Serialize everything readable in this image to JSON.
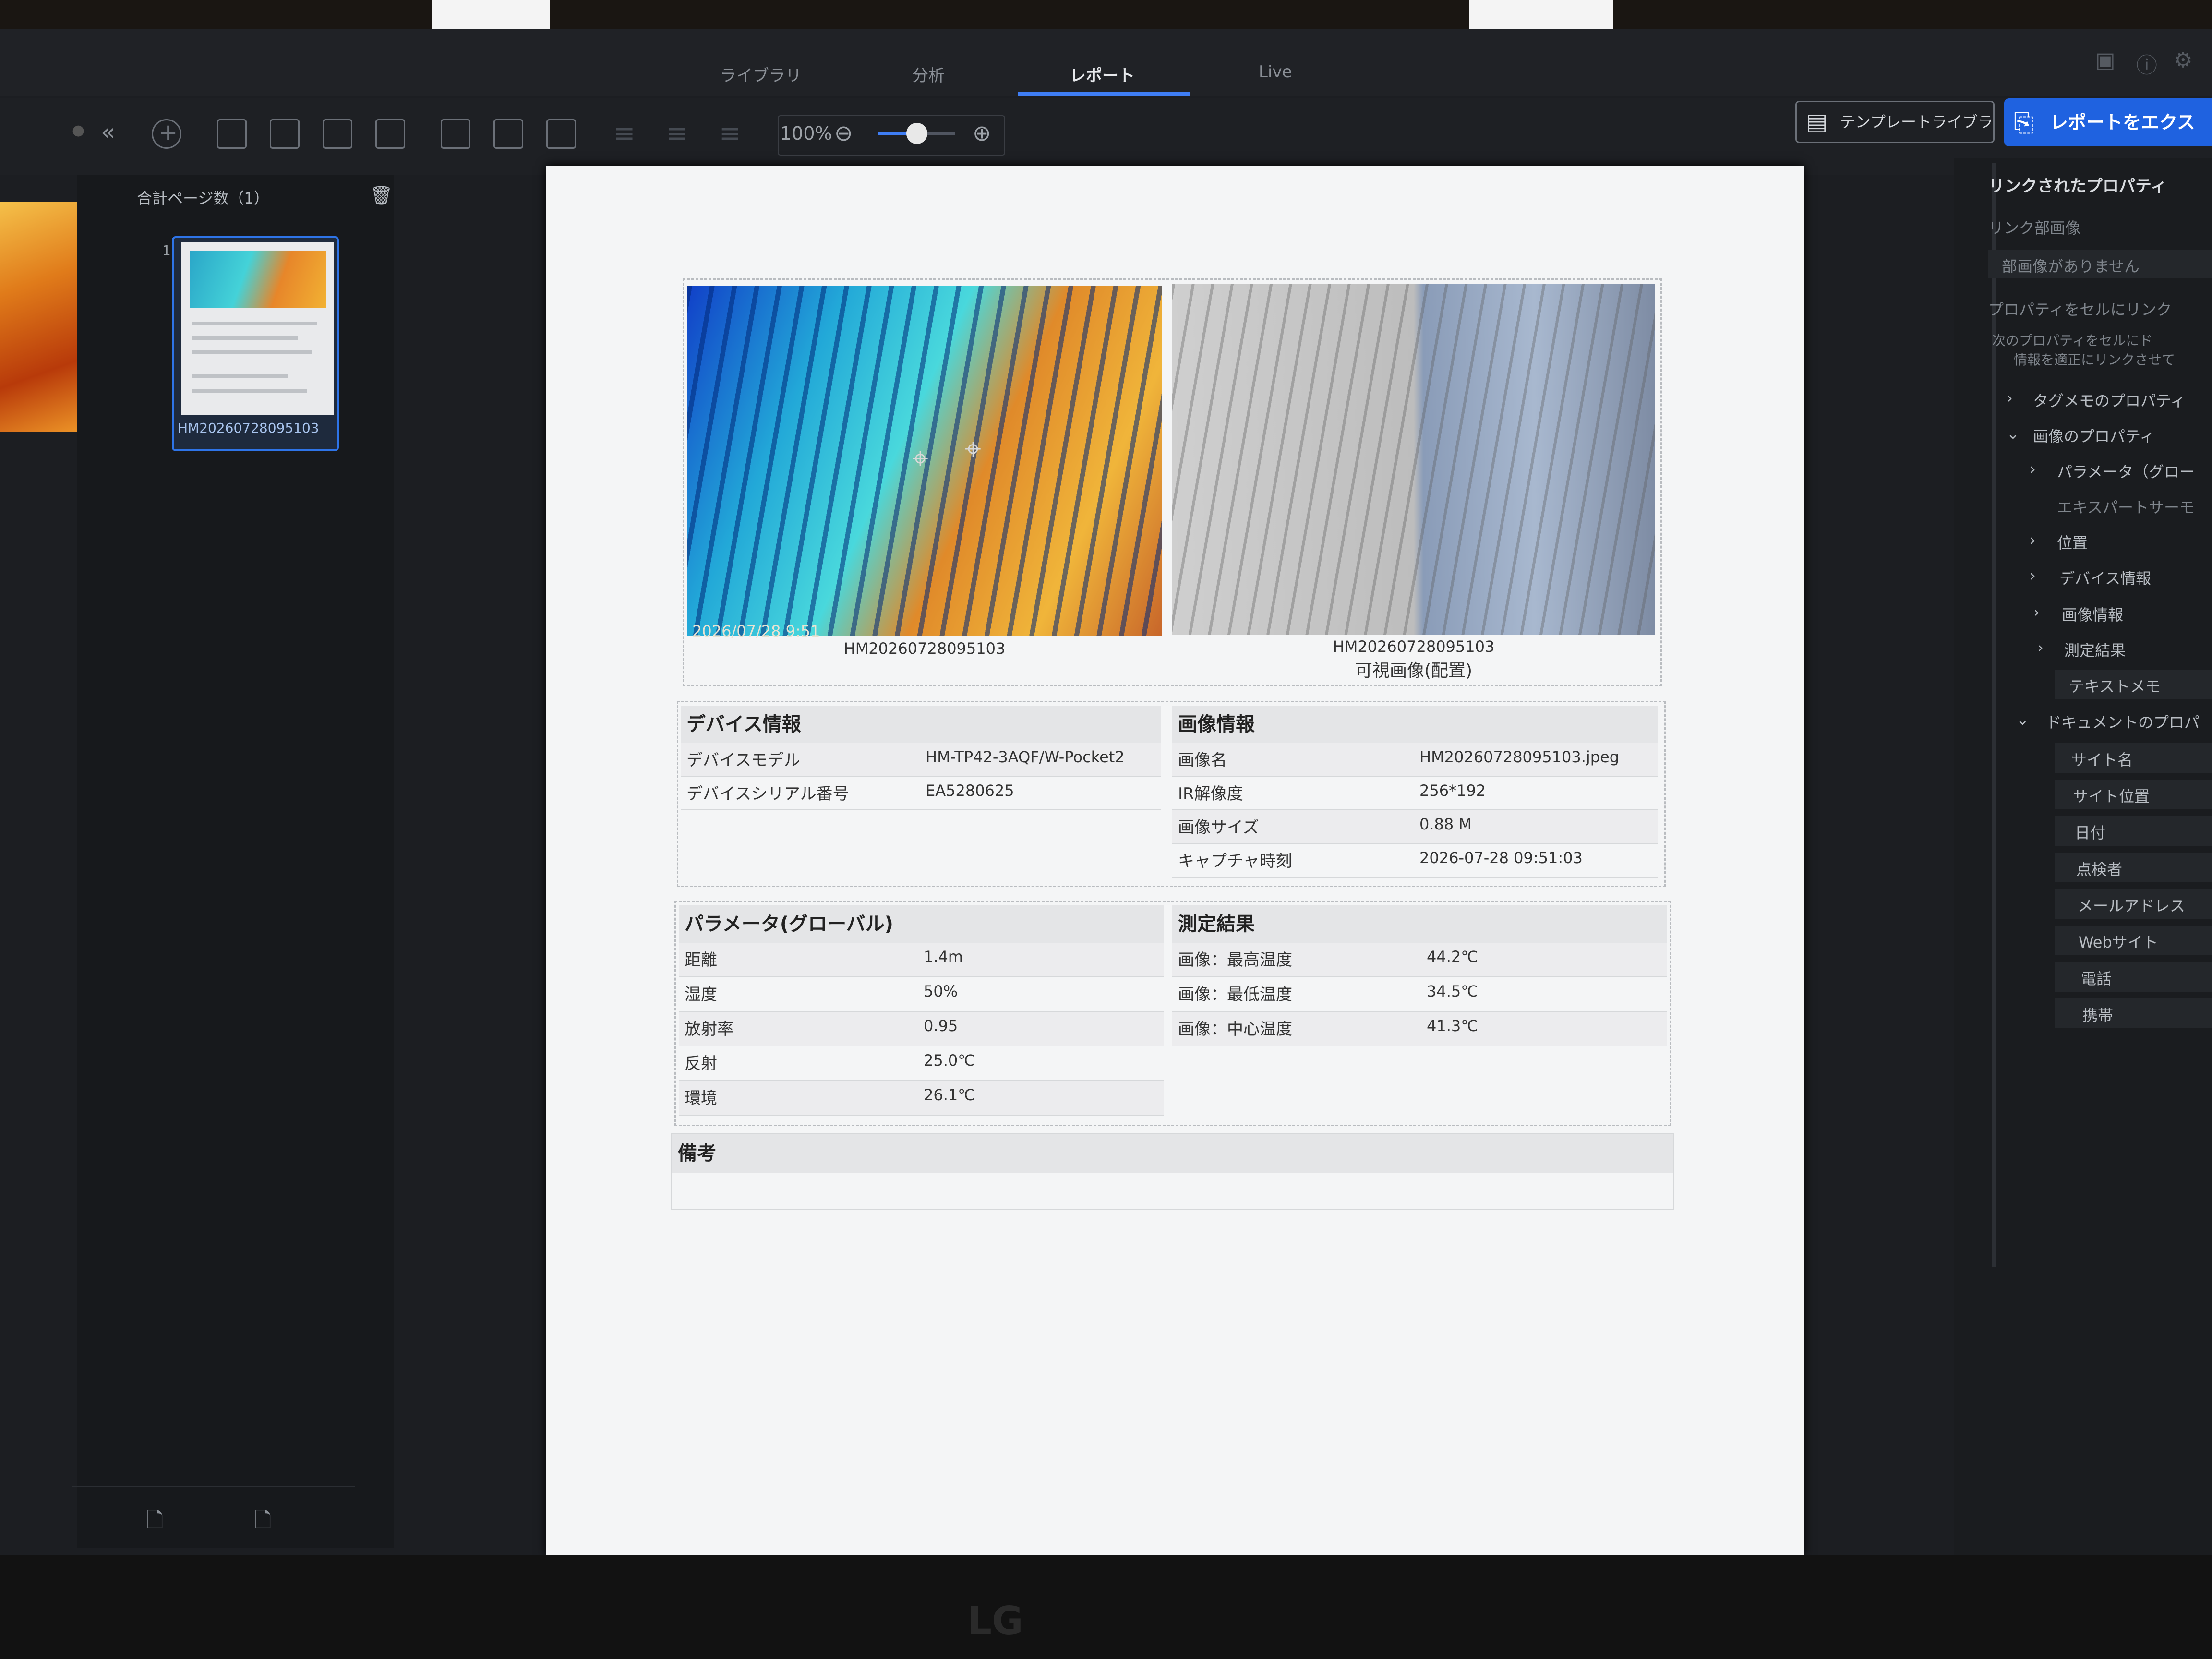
{
  "tabs": [
    {
      "label": "ライブラリ"
    },
    {
      "label": "分析"
    },
    {
      "label": "レポート"
    },
    {
      "label": "Live"
    }
  ],
  "toolbar": {
    "zoom": "100%",
    "zoom_value": 0.5,
    "template_library_label": "テンプレートライブラリー",
    "export_label": "レポートをエクス"
  },
  "pages_panel": {
    "title": "合計ページ数（1）",
    "page_number": "1",
    "thumb_label": "HM20260728095103"
  },
  "report": {
    "ir_timestamp": "2026/07/28 9:51",
    "ir_caption": "HM20260728095103",
    "vis_caption_1": "HM20260728095103",
    "vis_caption_2": "可視画像(配置)",
    "device": {
      "title": "デバイス情報",
      "rows": [
        {
          "k": "デバイスモデル",
          "v": "HM-TP42-3AQF/W-Pocket2"
        },
        {
          "k": "デバイスシリアル番号",
          "v": "EA5280625"
        }
      ]
    },
    "image": {
      "title": "画像情報",
      "rows": [
        {
          "k": "画像名",
          "v": "HM20260728095103.jpeg"
        },
        {
          "k": "IR解像度",
          "v": "256*192"
        },
        {
          "k": "画像サイズ",
          "v": "0.88 M"
        },
        {
          "k": "キャプチャ時刻",
          "v": "2026-07-28 09:51:03"
        }
      ]
    },
    "params": {
      "title": "パラメータ(グローバル)",
      "rows": [
        {
          "k": "距離",
          "v": "1.4m"
        },
        {
          "k": "湿度",
          "v": "50%"
        },
        {
          "k": "放射率",
          "v": "0.95"
        },
        {
          "k": "反射",
          "v": "25.0℃"
        },
        {
          "k": "環境",
          "v": "26.1℃"
        }
      ]
    },
    "results": {
      "title": "測定結果",
      "rows": [
        {
          "k": "画像：最高温度",
          "v": "44.2℃"
        },
        {
          "k": "画像：最低温度",
          "v": "34.5℃"
        },
        {
          "k": "画像：中心温度",
          "v": "41.3℃"
        }
      ]
    },
    "notes_title": "備考"
  },
  "props": {
    "title": "リンクされたプロパティ",
    "linked_image_label": "リンク部画像",
    "no_image": "部画像がありません",
    "link_props": "プロパティをセルにリンク",
    "hint_1": "次のプロパティをセルにド",
    "hint_2": "情報を適正にリンクさせて",
    "items": [
      "タグメモのプロパティ",
      "画像のプロパティ",
      "パラメータ（グロー",
      "エキスパートサーモ",
      "位置",
      "デバイス情報",
      "画像情報",
      "測定結果",
      "テキストメモ",
      "ドキュメントのプロパ",
      "サイト名",
      "サイト位置",
      "日付",
      "点検者",
      "メールアドレス",
      "Webサイト",
      "電話",
      "携帯"
    ]
  },
  "monitor_brand": "LG"
}
